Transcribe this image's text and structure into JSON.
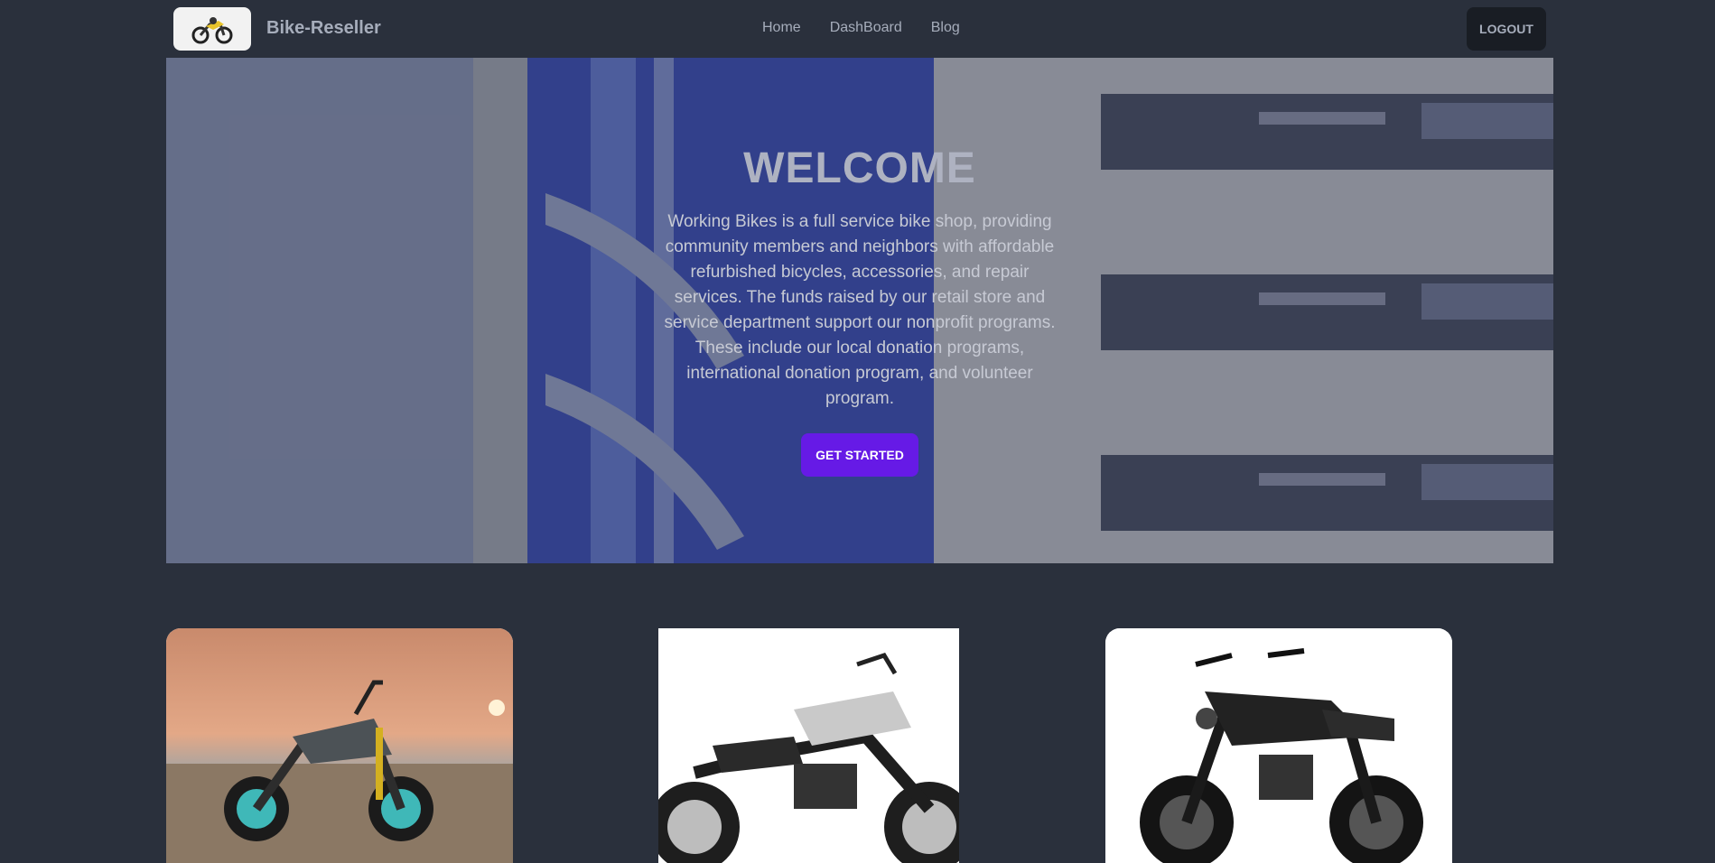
{
  "navbar": {
    "brand": "Bike-Reseller",
    "links": [
      "Home",
      "DashBoard",
      "Blog"
    ],
    "logout_label": "LOGOUT"
  },
  "hero": {
    "title": "WELCOME",
    "text": "Working Bikes is a full service bike shop, providing community members and neighbors with affordable refurbished bicycles, accessories, and repair services. The funds raised by our retail store and service department support our nonprofit programs. These include our local donation programs, international donation program, and volunteer program.",
    "cta_label": "GET STARTED"
  },
  "colors": {
    "background": "#2a303c",
    "text_muted": "#a6adbb",
    "primary": "#661ae6",
    "navbar_button": "#191d24"
  },
  "cards": [
    {
      "image": "naked-motorcycle-sunset-photo"
    },
    {
      "image": "cruiser-motorcycle-photo"
    },
    {
      "image": "black-power-cruiser-motorcycle-photo"
    }
  ]
}
